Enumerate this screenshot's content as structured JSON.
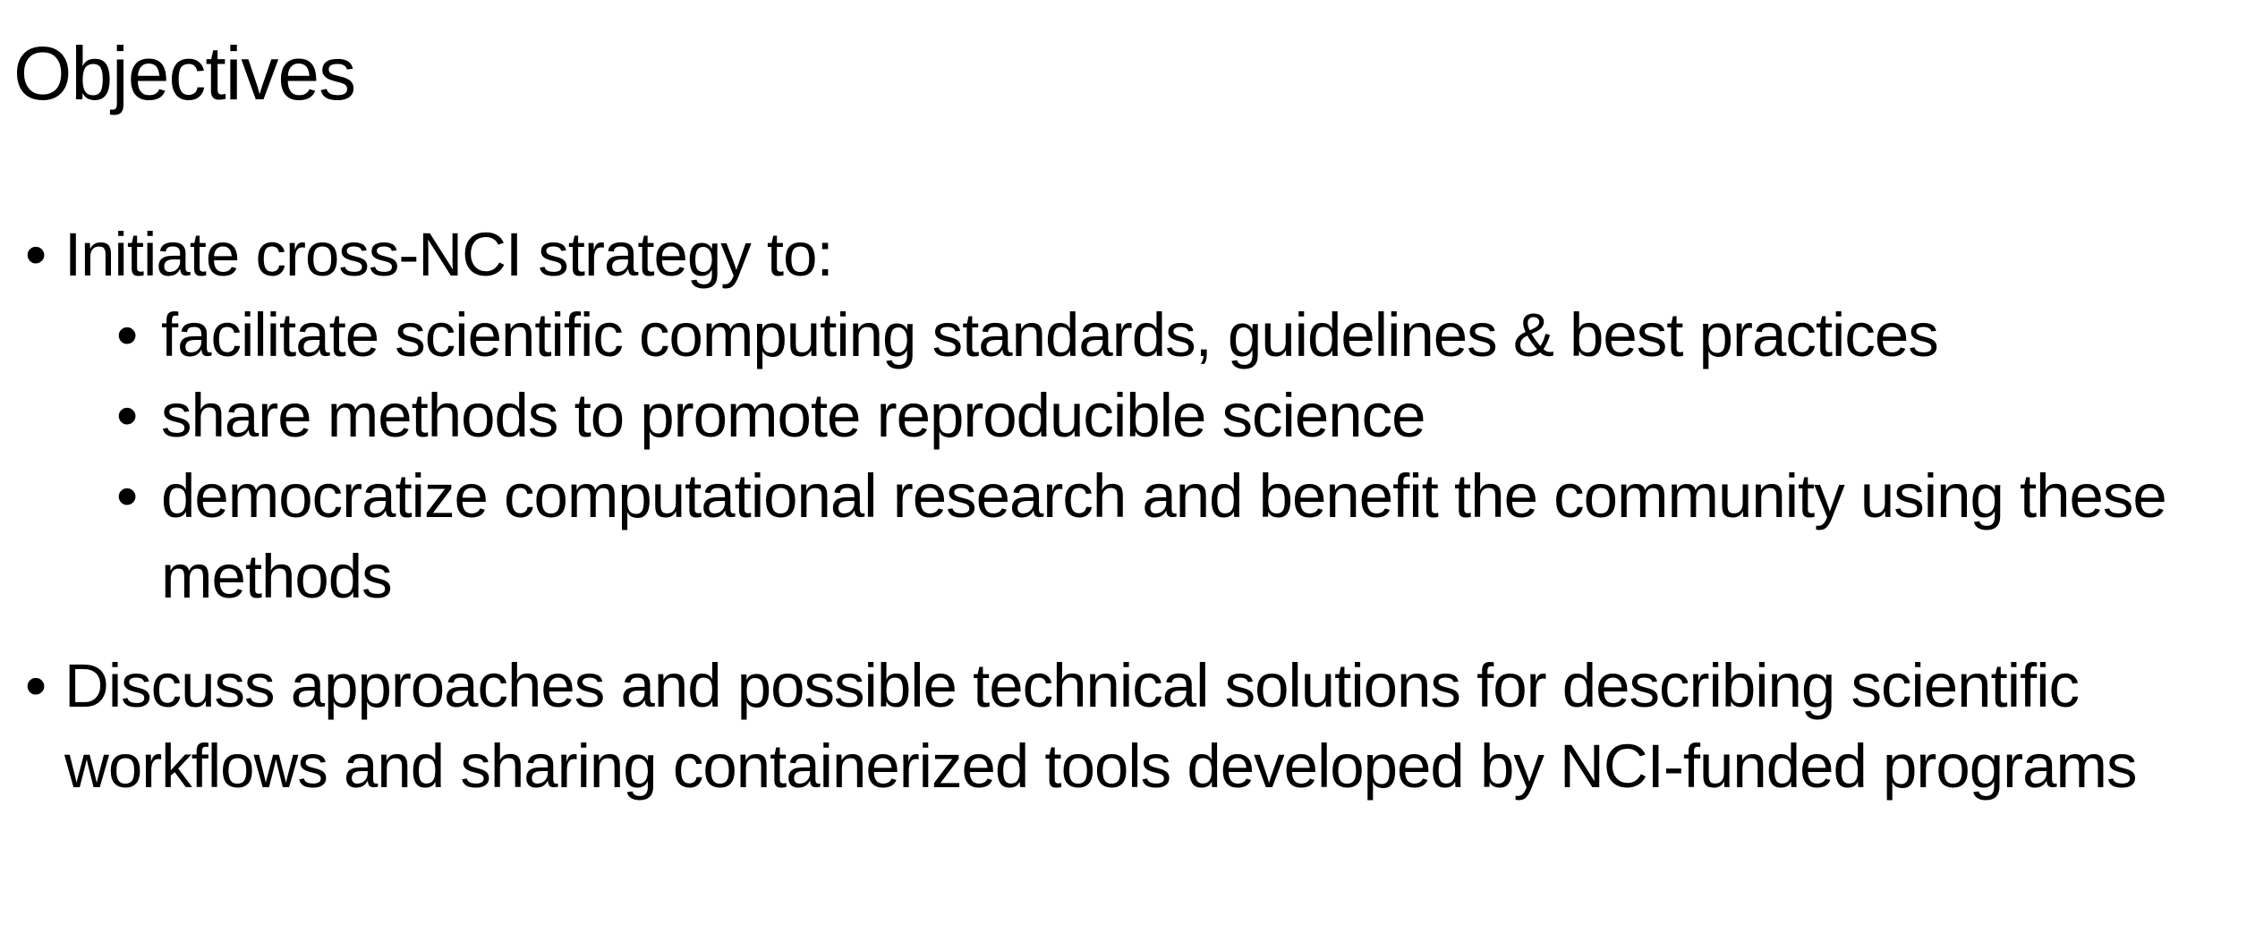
{
  "slide": {
    "title": "Objectives",
    "bullets": [
      {
        "text": "Initiate cross-NCI strategy to:",
        "sub": [
          "facilitate scientific computing standards, guidelines & best practices",
          "share methods to promote reproducible science",
          "democratize computational research and benefit the community using these methods"
        ]
      },
      {
        "text": "Discuss approaches and possible technical solutions for describing scientific workflows and sharing containerized tools developed by NCI-funded programs",
        "sub": []
      }
    ],
    "bullet_glyph": "•"
  }
}
